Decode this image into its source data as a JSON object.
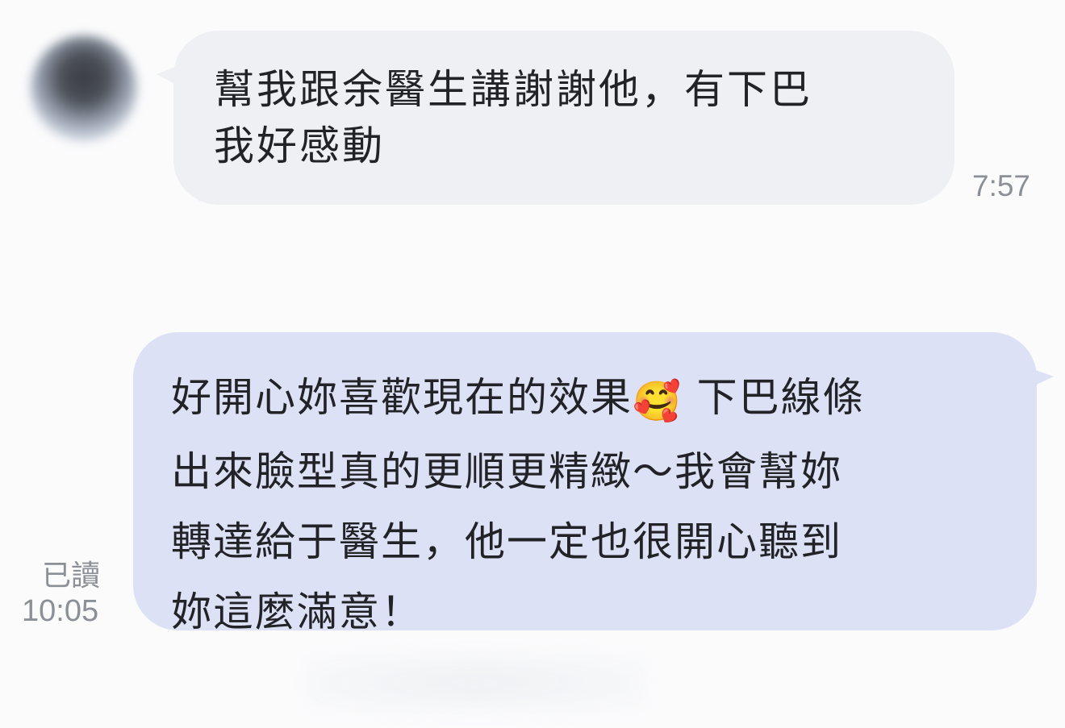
{
  "incoming": {
    "text_line1": "幫我跟余醫生講謝謝他，有下巴",
    "text_line2": "我好感動",
    "time": "7:57"
  },
  "outgoing": {
    "line1_before_emoji": "好開心妳喜歡現在的效果",
    "emoji": "🥰",
    "line1_after_emoji": " 下巴線條",
    "line2": "出來臉型真的更順更精緻～我會幫妳",
    "line3": "轉達給于醫生，他一定也很開心聽到",
    "line4": "妳這麼滿意！",
    "read_status": "已讀",
    "time": "10:05"
  },
  "colors": {
    "background": "#fbfbfc",
    "incoming_bubble": "#eef0f3",
    "outgoing_bubble": "#dde1f6",
    "meta_text": "#8b8f96"
  }
}
